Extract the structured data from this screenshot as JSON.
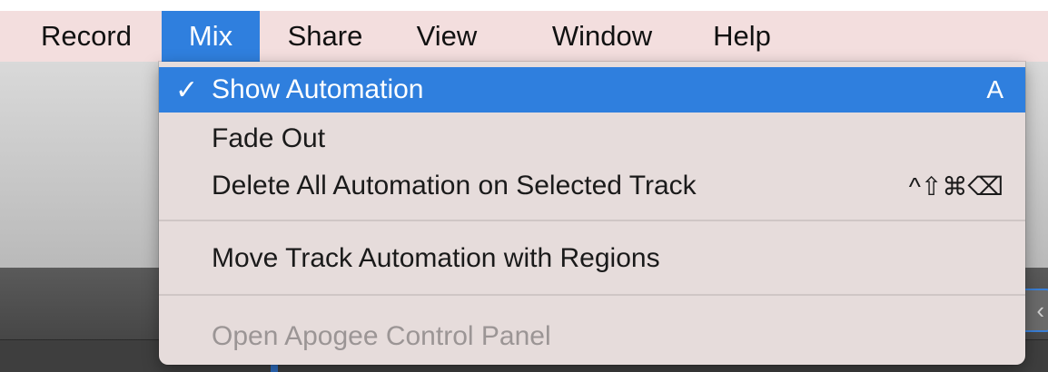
{
  "menubar": {
    "items": [
      {
        "label": "Record",
        "active": false
      },
      {
        "label": "Mix",
        "active": true
      },
      {
        "label": "Share",
        "active": false
      },
      {
        "label": "View",
        "active": false
      },
      {
        "label": "Window",
        "active": false
      },
      {
        "label": "Help",
        "active": false
      }
    ]
  },
  "mix_menu": {
    "items": [
      {
        "check": "✓",
        "label": "Show Automation",
        "shortcut": "A",
        "selected": true,
        "disabled": false
      },
      {
        "check": "",
        "label": "Fade Out",
        "shortcut": "",
        "selected": false,
        "disabled": false
      },
      {
        "check": "",
        "label": "Delete All Automation on Selected Track",
        "shortcut": "^⇧⌘⌫",
        "selected": false,
        "disabled": false
      },
      {
        "check": "",
        "label": "Move Track Automation with Regions",
        "shortcut": "",
        "selected": false,
        "disabled": false
      },
      {
        "check": "",
        "label": "Open Apogee Control Panel",
        "shortcut": "",
        "selected": false,
        "disabled": true
      }
    ]
  },
  "colors": {
    "menubar_bg": "#f3dede",
    "accent": "#2f7fde",
    "menu_bg": "#e6dcdb",
    "disabled_text": "#9b9595"
  }
}
